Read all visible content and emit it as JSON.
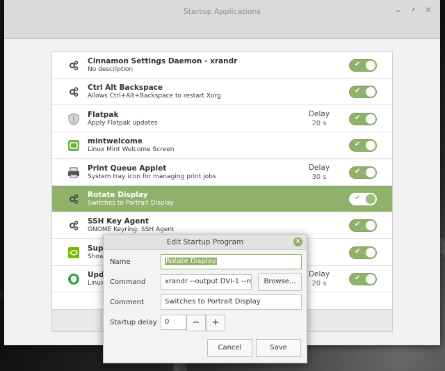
{
  "window": {
    "title": "Startup Applications"
  },
  "apps": [
    {
      "name": "Cinnamon Settings Daemon - xrandr",
      "description": "No description",
      "icon": "gear-icon",
      "delay_label": "",
      "delay_value": "",
      "enabled": true,
      "selected": false
    },
    {
      "name": "Ctrl Alt Backspace",
      "description": "Allows Ctrl+Alt+Backspace to restart Xorg",
      "icon": "gear-icon",
      "delay_label": "",
      "delay_value": "",
      "enabled": true,
      "selected": false
    },
    {
      "name": "Flatpak",
      "description": "Apply Flatpak updates",
      "icon": "shield-icon",
      "delay_label": "Delay",
      "delay_value": "20 s",
      "enabled": true,
      "selected": false
    },
    {
      "name": "mintwelcome",
      "description": "Linux Mint Welcome Screen",
      "icon": "mint-welcome-icon",
      "delay_label": "",
      "delay_value": "",
      "enabled": true,
      "selected": false
    },
    {
      "name": "Print Queue Applet",
      "description": "System tray icon for managing print jobs",
      "icon": "printer-icon",
      "delay_label": "Delay",
      "delay_value": "30 s",
      "enabled": true,
      "selected": false
    },
    {
      "name": "Rotate Display",
      "description": "Switches to Portrait Display",
      "icon": "gear-icon",
      "delay_label": "",
      "delay_value": "",
      "enabled": true,
      "selected": true
    },
    {
      "name": "SSH Key Agent",
      "description": "GNOME Keyring: SSH Agent",
      "icon": "gear-icon",
      "delay_label": "",
      "delay_value": "",
      "enabled": true,
      "selected": false
    },
    {
      "name": "Supp",
      "description": "Show",
      "icon": "nvidia-icon",
      "delay_label": "",
      "delay_value": "",
      "enabled": true,
      "selected": false
    },
    {
      "name": "Upda",
      "description": "Linux",
      "icon": "update-shield-icon",
      "delay_label": "Delay",
      "delay_value": "20 s",
      "enabled": true,
      "selected": false
    }
  ],
  "dialog": {
    "title": "Edit Startup Program",
    "name_label": "Name",
    "name_value": "Rotate Display",
    "command_label": "Command",
    "command_value": "xrandr --output DVI-1 --ro",
    "browse_label": "Browse...",
    "comment_label": "Comment",
    "comment_value": "Switches to Portrait Display",
    "delay_label": "Startup delay",
    "delay_value": "0",
    "minus_label": "−",
    "plus_label": "+",
    "cancel_label": "Cancel",
    "save_label": "Save"
  },
  "colors": {
    "accent": "#8fb16a",
    "selected_row": "#8fb16a"
  }
}
